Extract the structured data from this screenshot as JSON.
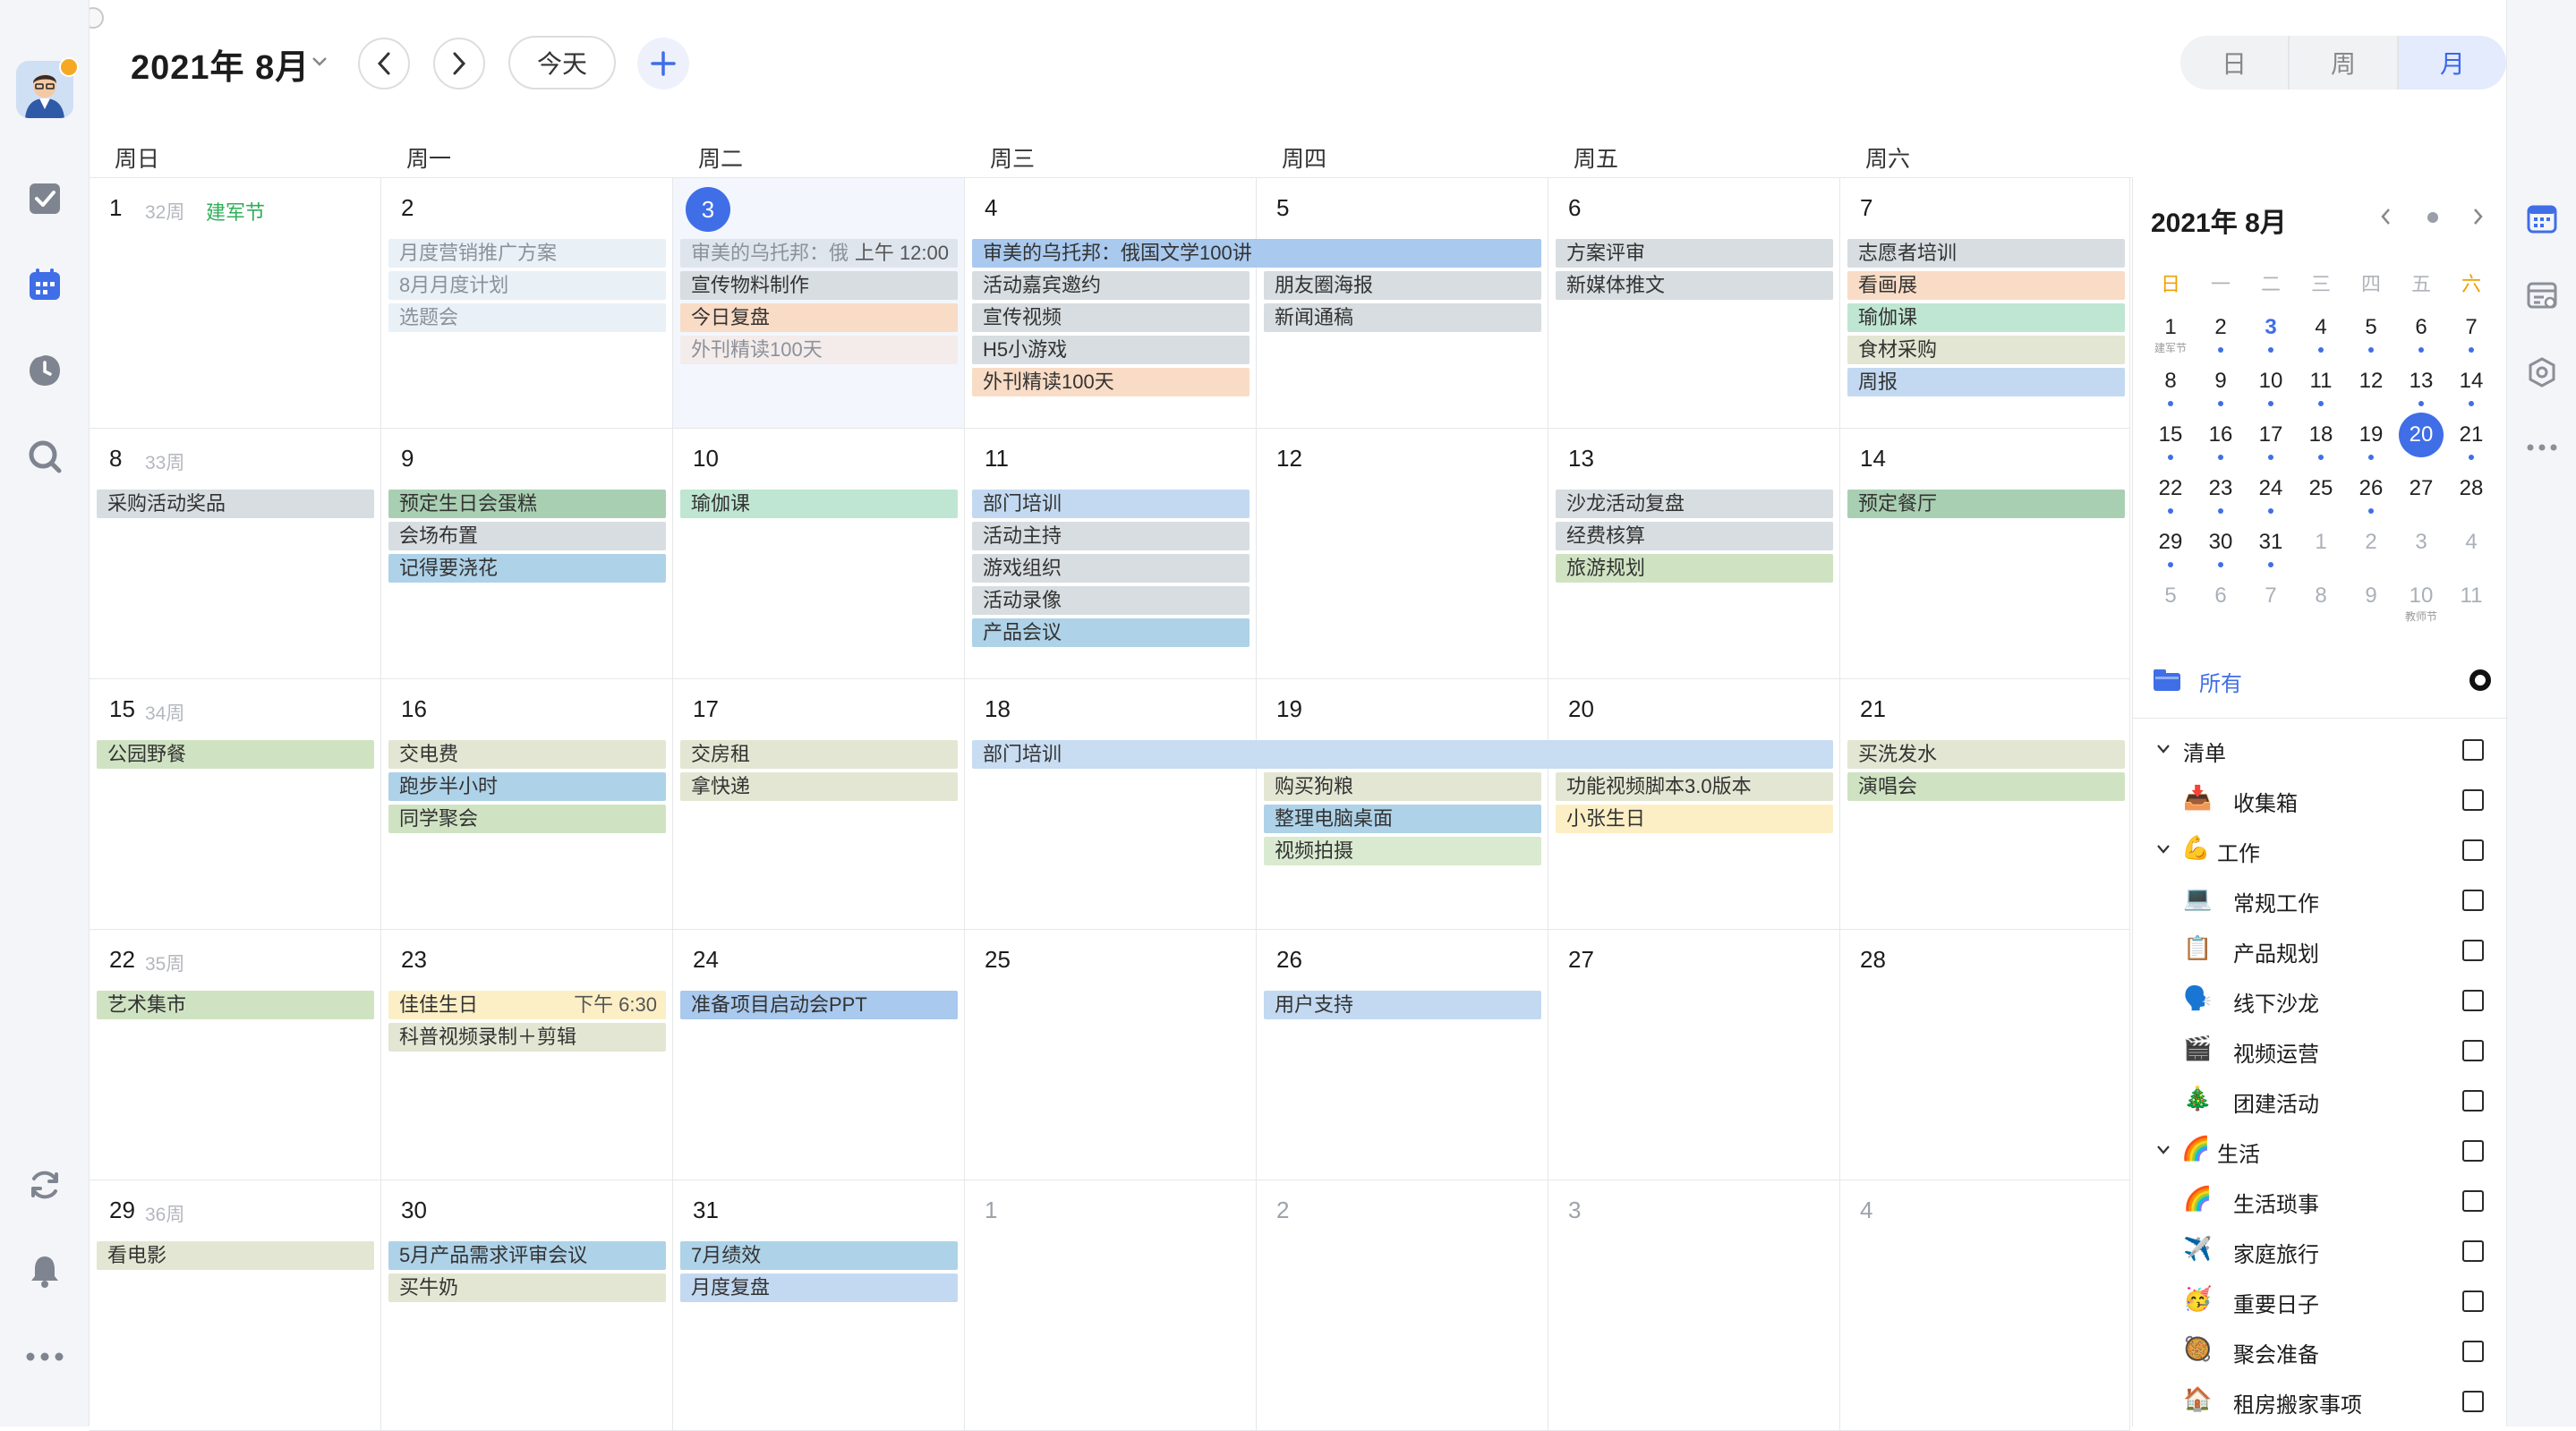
{
  "header": {
    "month_title": "2021年 8月",
    "today_label": "今天"
  },
  "view_switch": {
    "day": "日",
    "week": "周",
    "month": "月"
  },
  "weekdays": [
    "周日",
    "周一",
    "周二",
    "周三",
    "周四",
    "周五",
    "周六"
  ],
  "colors": {
    "accent": "#3f6ee7",
    "holiday": "#2fae5a"
  },
  "weeks": [
    {
      "week_label": "32周",
      "days": [
        {
          "num": "1",
          "holiday": "建军节",
          "events": []
        },
        {
          "num": "2",
          "events": [
            {
              "title": "月度营销推广方案",
              "color": "#e9f0f6",
              "faded": true
            },
            {
              "title": "8月月度计划",
              "color": "#e9f0f6",
              "faded": true
            },
            {
              "title": "选题会",
              "color": "#e9f0f6",
              "faded": true
            }
          ]
        },
        {
          "num": "3",
          "today": true,
          "events": [
            {
              "title": "审美的乌托邦：俄",
              "time": "上午 12:00",
              "color": "#dfe5ec",
              "faded": true
            },
            {
              "title": "宣传物料制作",
              "color": "#d7dde0"
            },
            {
              "title": "今日复盘",
              "color": "#f9dcc6"
            },
            {
              "title": "外刊精读100天",
              "color": "#f3eceb",
              "faded": true
            }
          ]
        },
        {
          "num": "4",
          "events": [
            {
              "title": "审美的乌托邦：俄国文学100讲",
              "color": "#a9c9ee",
              "span": 2
            },
            {
              "title": "活动嘉宾邀约",
              "color": "#d7dde0"
            },
            {
              "title": "宣传视频",
              "color": "#d7dde0"
            },
            {
              "title": "H5小游戏",
              "color": "#d7dde0"
            },
            {
              "title": "外刊精读100天",
              "color": "#f9dcc6"
            }
          ]
        },
        {
          "num": "5",
          "events": [
            {
              "skip": true
            },
            {
              "title": "朋友圈海报",
              "color": "#d7dde0"
            },
            {
              "title": "新闻通稿",
              "color": "#d7dde0"
            }
          ]
        },
        {
          "num": "6",
          "events": [
            {
              "title": "方案评审",
              "color": "#d7dde0"
            },
            {
              "title": "新媒体推文",
              "color": "#d7dde0"
            }
          ]
        },
        {
          "num": "7",
          "events": [
            {
              "title": "志愿者培训",
              "color": "#d7dde0"
            },
            {
              "title": "看画展",
              "color": "#f9dcc6"
            },
            {
              "title": "瑜伽课",
              "color": "#bfe6d2"
            },
            {
              "title": "食材采购",
              "color": "#e3e6d2"
            },
            {
              "title": "周报",
              "color": "#c3d9f1"
            }
          ]
        }
      ]
    },
    {
      "week_label": "33周",
      "days": [
        {
          "num": "8",
          "events": [
            {
              "title": "采购活动奖品",
              "color": "#d7dde0"
            }
          ]
        },
        {
          "num": "9",
          "events": [
            {
              "title": "预定生日会蛋糕",
              "color": "#a9cfb3"
            },
            {
              "title": "会场布置",
              "color": "#d7dde0"
            },
            {
              "title": "记得要浇花",
              "color": "#aed2e8"
            }
          ]
        },
        {
          "num": "10",
          "events": [
            {
              "title": "瑜伽课",
              "color": "#bfe6d2"
            }
          ]
        },
        {
          "num": "11",
          "events": [
            {
              "title": "部门培训",
              "color": "#c3d9f1"
            },
            {
              "title": "活动主持",
              "color": "#d7dde0"
            },
            {
              "title": "游戏组织",
              "color": "#d7dde0"
            },
            {
              "title": "活动录像",
              "color": "#d7dde0"
            },
            {
              "title": "产品会议",
              "color": "#aed2e8"
            }
          ]
        },
        {
          "num": "12",
          "events": []
        },
        {
          "num": "13",
          "events": [
            {
              "title": "沙龙活动复盘",
              "color": "#d7dde0"
            },
            {
              "title": "经费核算",
              "color": "#d7dde0"
            },
            {
              "title": "旅游规划",
              "color": "#cfe3c2"
            }
          ]
        },
        {
          "num": "14",
          "events": [
            {
              "title": "预定餐厅",
              "color": "#a9cfb3"
            }
          ]
        }
      ]
    },
    {
      "week_label": "34周",
      "days": [
        {
          "num": "15",
          "events": [
            {
              "title": "公园野餐",
              "color": "#cfe3c2"
            }
          ]
        },
        {
          "num": "16",
          "events": [
            {
              "title": "交电费",
              "color": "#e3e6d2"
            },
            {
              "title": "跑步半小时",
              "color": "#aed2e8"
            },
            {
              "title": "同学聚会",
              "color": "#cfe3c2"
            }
          ]
        },
        {
          "num": "17",
          "events": [
            {
              "title": "交房租",
              "color": "#e3e6d2"
            },
            {
              "title": "拿快递",
              "color": "#e3e6d2"
            }
          ]
        },
        {
          "num": "18",
          "events": [
            {
              "title": "部门培训",
              "color": "#c8dcf2",
              "span": 3
            }
          ]
        },
        {
          "num": "19",
          "events": [
            {
              "skip": true
            },
            {
              "title": "购买狗粮",
              "color": "#e3e6d2"
            },
            {
              "title": "整理电脑桌面",
              "color": "#aed2e8"
            },
            {
              "title": "视频拍摄",
              "color": "#d9ead0"
            }
          ]
        },
        {
          "num": "20",
          "events": [
            {
              "skip": true
            },
            {
              "title": "功能视频脚本3.0版本",
              "color": "#e3e6d2"
            },
            {
              "title": "小张生日",
              "color": "#fcefc5"
            }
          ]
        },
        {
          "num": "21",
          "events": [
            {
              "title": "买洗发水",
              "color": "#e3e6d2"
            },
            {
              "title": "演唱会",
              "color": "#cfe3c2"
            }
          ]
        }
      ]
    },
    {
      "week_label": "35周",
      "days": [
        {
          "num": "22",
          "events": [
            {
              "title": "艺术集市",
              "color": "#cfe3c2"
            }
          ]
        },
        {
          "num": "23",
          "events": [
            {
              "title": "佳佳生日",
              "time": "下午 6:30",
              "color": "#fcefc5"
            },
            {
              "title": "科普视频录制＋剪辑",
              "color": "#e3e6d2"
            }
          ]
        },
        {
          "num": "24",
          "events": [
            {
              "title": "准备项目启动会PPT",
              "color": "#a9c9ee"
            }
          ]
        },
        {
          "num": "25",
          "events": []
        },
        {
          "num": "26",
          "events": [
            {
              "title": "用户支持",
              "color": "#c3d9f1"
            }
          ]
        },
        {
          "num": "27",
          "events": []
        },
        {
          "num": "28",
          "events": []
        }
      ]
    },
    {
      "week_label": "36周",
      "days": [
        {
          "num": "29",
          "events": [
            {
              "title": "看电影",
              "color": "#e3e6d2"
            }
          ]
        },
        {
          "num": "30",
          "events": [
            {
              "title": "5月产品需求评审会议",
              "color": "#aed2e8"
            },
            {
              "title": "买牛奶",
              "color": "#e3e6d2"
            }
          ]
        },
        {
          "num": "31",
          "events": [
            {
              "title": "7月绩效",
              "color": "#aed2e8"
            },
            {
              "title": "月度复盘",
              "color": "#c3d9f1"
            }
          ]
        },
        {
          "num": "1",
          "dim": true,
          "events": []
        },
        {
          "num": "2",
          "dim": true,
          "events": []
        },
        {
          "num": "3",
          "dim": true,
          "events": []
        },
        {
          "num": "4",
          "dim": true,
          "events": []
        }
      ]
    }
  ],
  "mini_calendar": {
    "title": "2021年 8月",
    "weekdays": [
      "日",
      "一",
      "二",
      "三",
      "四",
      "五",
      "六"
    ],
    "weekday_colors": [
      "#f0a000",
      "#b0b3ba",
      "#b0b3ba",
      "#b0b3ba",
      "#b0b3ba",
      "#b0b3ba",
      "#f0a000"
    ],
    "rows": [
      [
        {
          "n": "1",
          "sub": "建军节"
        },
        {
          "n": "2",
          "dot": true
        },
        {
          "n": "3",
          "dot": true,
          "blue": true
        },
        {
          "n": "4",
          "dot": true
        },
        {
          "n": "5",
          "dot": true
        },
        {
          "n": "6",
          "dot": true
        },
        {
          "n": "7",
          "dot": true
        }
      ],
      [
        {
          "n": "8",
          "dot": true
        },
        {
          "n": "9",
          "dot": true
        },
        {
          "n": "10",
          "dot": true
        },
        {
          "n": "11",
          "dot": true
        },
        {
          "n": "12"
        },
        {
          "n": "13",
          "dot": true
        },
        {
          "n": "14",
          "dot": true
        }
      ],
      [
        {
          "n": "15",
          "dot": true
        },
        {
          "n": "16",
          "dot": true
        },
        {
          "n": "17",
          "dot": true
        },
        {
          "n": "18",
          "dot": true
        },
        {
          "n": "19",
          "dot": true
        },
        {
          "n": "20",
          "sel": true
        },
        {
          "n": "21",
          "dot": true
        }
      ],
      [
        {
          "n": "22",
          "dot": true
        },
        {
          "n": "23",
          "dot": true
        },
        {
          "n": "24",
          "dot": true
        },
        {
          "n": "25"
        },
        {
          "n": "26",
          "dot": true
        },
        {
          "n": "27"
        },
        {
          "n": "28"
        }
      ],
      [
        {
          "n": "29",
          "dot": true
        },
        {
          "n": "30",
          "dot": true
        },
        {
          "n": "31",
          "dot": true
        },
        {
          "n": "1",
          "dim": true
        },
        {
          "n": "2",
          "dim": true
        },
        {
          "n": "3",
          "dim": true
        },
        {
          "n": "4",
          "dim": true
        }
      ],
      [
        {
          "n": "5",
          "dim": true
        },
        {
          "n": "6",
          "dim": true
        },
        {
          "n": "7",
          "dim": true
        },
        {
          "n": "8",
          "dim": true
        },
        {
          "n": "9",
          "dim": true
        },
        {
          "n": "10",
          "dim": true,
          "sub": "教师节"
        },
        {
          "n": "11",
          "dim": true
        }
      ]
    ]
  },
  "filter": {
    "all_label": "所有"
  },
  "lists": [
    {
      "label": "清单",
      "level": 0,
      "chevron": true
    },
    {
      "label": "收集箱",
      "level": 1,
      "emoji": "📥"
    },
    {
      "label": "工作",
      "level": 0,
      "chevron": true,
      "emoji": "💪"
    },
    {
      "label": "常规工作",
      "level": 1,
      "emoji": "💻"
    },
    {
      "label": "产品规划",
      "level": 1,
      "emoji": "📋"
    },
    {
      "label": "线下沙龙",
      "level": 1,
      "emoji": "🗣️"
    },
    {
      "label": "视频运营",
      "level": 1,
      "emoji": "🎬"
    },
    {
      "label": "团建活动",
      "level": 1,
      "emoji": "🎄"
    },
    {
      "label": "生活",
      "level": 0,
      "chevron": true,
      "emoji": "🌈"
    },
    {
      "label": "生活琐事",
      "level": 1,
      "emoji": "🌈"
    },
    {
      "label": "家庭旅行",
      "level": 1,
      "emoji": "✈️"
    },
    {
      "label": "重要日子",
      "level": 1,
      "emoji": "🥳"
    },
    {
      "label": "聚会准备",
      "level": 1,
      "emoji": "🥘"
    },
    {
      "label": "租房搬家事项",
      "level": 1,
      "emoji": "🏠"
    }
  ]
}
